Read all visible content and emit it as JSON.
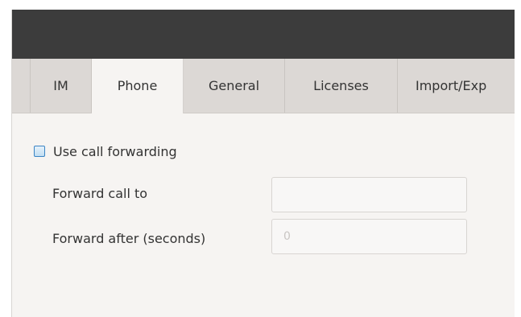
{
  "tabs": [
    {
      "label": "",
      "name": "tab-left-partial"
    },
    {
      "label": "IM",
      "name": "tab-im"
    },
    {
      "label": "Phone",
      "name": "tab-phone",
      "active": true
    },
    {
      "label": "General",
      "name": "tab-general"
    },
    {
      "label": "Licenses",
      "name": "tab-licenses"
    },
    {
      "label": "Import/Exp",
      "name": "tab-import-export"
    }
  ],
  "phone": {
    "use_call_forwarding_label": "Use call forwarding",
    "use_call_forwarding_checked": false,
    "forward_call_to_label": "Forward call to",
    "forward_call_to_value": "",
    "forward_after_label": "Forward after (seconds)",
    "forward_after_placeholder": "0"
  },
  "colors": {
    "titlebar": "#3c3c3c",
    "tabbar": "#dcd8d5",
    "active_tab": "#f6f4f2",
    "checkbox_border": "#3a84c4"
  }
}
